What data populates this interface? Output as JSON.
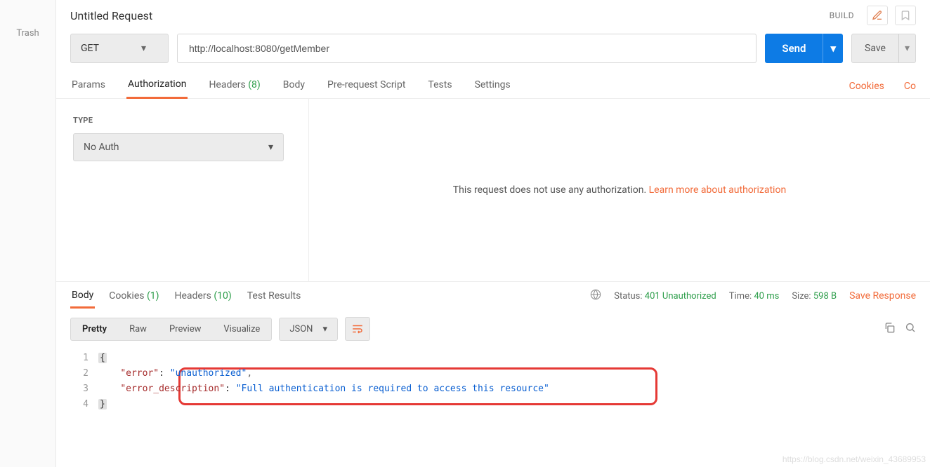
{
  "sidebar": {
    "trash": "Trash"
  },
  "header": {
    "title": "Untitled Request",
    "build": "BUILD"
  },
  "request": {
    "method": "GET",
    "url": "http://localhost:8080/getMember",
    "send_label": "Send",
    "save_label": "Save"
  },
  "tabs": {
    "params": "Params",
    "authorization": "Authorization",
    "headers_label": "Headers",
    "headers_count": "(8)",
    "body": "Body",
    "prerequest": "Pre-request Script",
    "tests": "Tests",
    "settings": "Settings",
    "cookies_link": "Cookies",
    "code_link": "Co"
  },
  "auth": {
    "type_label": "TYPE",
    "type_value": "No Auth",
    "msg_prefix": "This request does not use any authorization. ",
    "msg_link": "Learn more about authorization"
  },
  "response_tabs": {
    "body": "Body",
    "cookies_label": "Cookies",
    "cookies_count": "(1)",
    "headers_label": "Headers",
    "headers_count": "(10)",
    "tests": "Test Results"
  },
  "response_meta": {
    "status_label": "Status:",
    "status_value": "401 Unauthorized",
    "time_label": "Time:",
    "time_value": "40 ms",
    "size_label": "Size:",
    "size_value": "598 B",
    "save_response": "Save Response"
  },
  "format_row": {
    "pretty": "Pretty",
    "raw": "Raw",
    "preview": "Preview",
    "visualize": "Visualize",
    "lang": "JSON"
  },
  "code": {
    "line1_content": "{",
    "line2_key": "\"error\"",
    "line2_val": "\"unauthorized\"",
    "line3_key": "\"error_description\"",
    "line3_val": "\"Full authentication is required to access this resource\"",
    "line4_content": "}"
  },
  "watermark": "https://blog.csdn.net/weixin_43689953"
}
